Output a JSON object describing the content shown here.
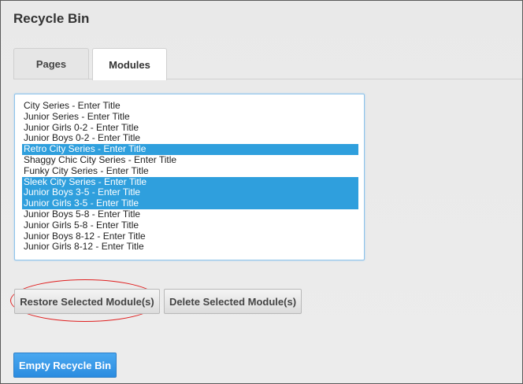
{
  "header": {
    "title": "Recycle Bin"
  },
  "tabs": [
    {
      "label": "Pages",
      "active": false
    },
    {
      "label": "Modules",
      "active": true
    }
  ],
  "modules_list": {
    "items": [
      {
        "label": "City Series - Enter Title",
        "selected": false
      },
      {
        "label": "Junior Series - Enter Title",
        "selected": false
      },
      {
        "label": "Junior Girls 0-2 - Enter Title",
        "selected": false
      },
      {
        "label": "Junior Boys 0-2 - Enter Title",
        "selected": false
      },
      {
        "label": "Retro City Series - Enter Title",
        "selected": true
      },
      {
        "label": "Shaggy Chic City Series - Enter Title",
        "selected": false
      },
      {
        "label": "Funky City Series - Enter Title",
        "selected": false
      },
      {
        "label": "Sleek City Series - Enter Title",
        "selected": true
      },
      {
        "label": "Junior Boys 3-5 - Enter Title",
        "selected": true
      },
      {
        "label": "Junior Girls 3-5 - Enter Title",
        "selected": true
      },
      {
        "label": "Junior Boys 5-8 - Enter Title",
        "selected": false
      },
      {
        "label": "Junior Girls 5-8 - Enter Title",
        "selected": false
      },
      {
        "label": "Junior Boys 8-12 - Enter Title",
        "selected": false
      },
      {
        "label": "Junior Girls 8-12 - Enter Title",
        "selected": false
      }
    ]
  },
  "actions": {
    "restore_label": "Restore Selected Module(s)",
    "delete_label": "Delete Selected Module(s)",
    "empty_label": "Empty Recycle Bin"
  },
  "colors": {
    "selection": "#2f9fdd",
    "primary_button": "#2b8ce0",
    "annotation_ring": "#e02020"
  }
}
